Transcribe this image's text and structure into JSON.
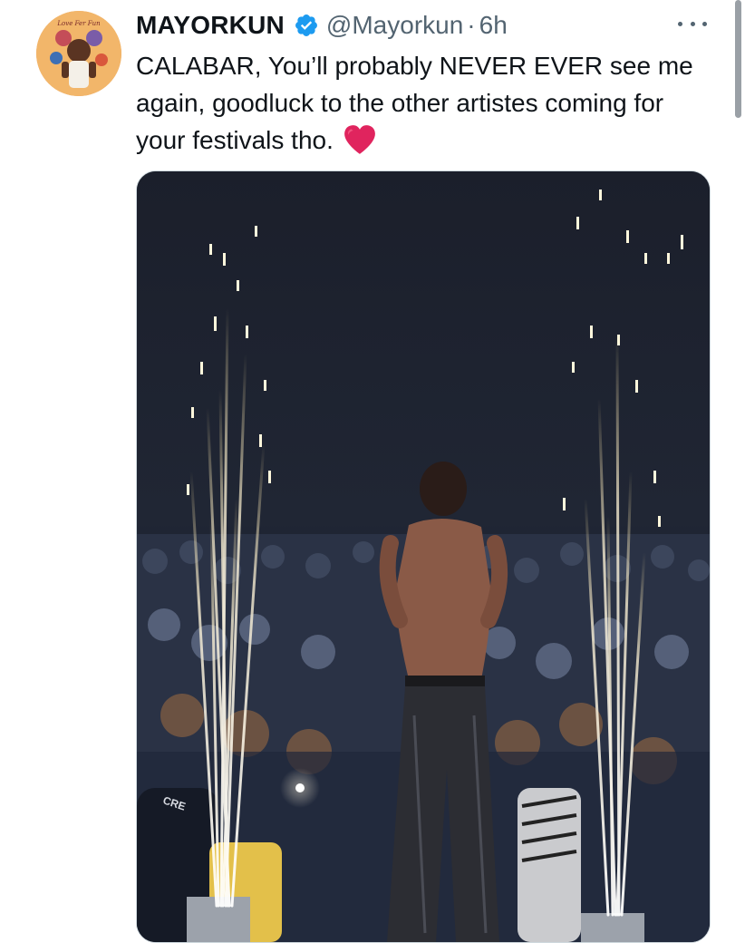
{
  "tweet": {
    "display_name": "MAYORKUN",
    "handle": "@Mayorkun",
    "separator": "·",
    "timestamp": "6h",
    "text": "CALABAR, You’ll probably NEVER EVER  see me again, goodluck to the other artistes coming for your festivals tho.",
    "emoji": "red-heart",
    "verified": true
  },
  "avatar": {
    "icon": "profile-avatar",
    "caption": "Love Fer Fun"
  },
  "media": {
    "shirt_text": "CRE"
  },
  "colors": {
    "text_primary": "#0f1419",
    "text_secondary": "#536471",
    "verified_blue": "#1d9bf0",
    "heart_red": "#e0245e"
  },
  "icons": {
    "more": "more-options-icon",
    "verified": "verified-badge-icon",
    "heart": "red-heart-icon"
  }
}
